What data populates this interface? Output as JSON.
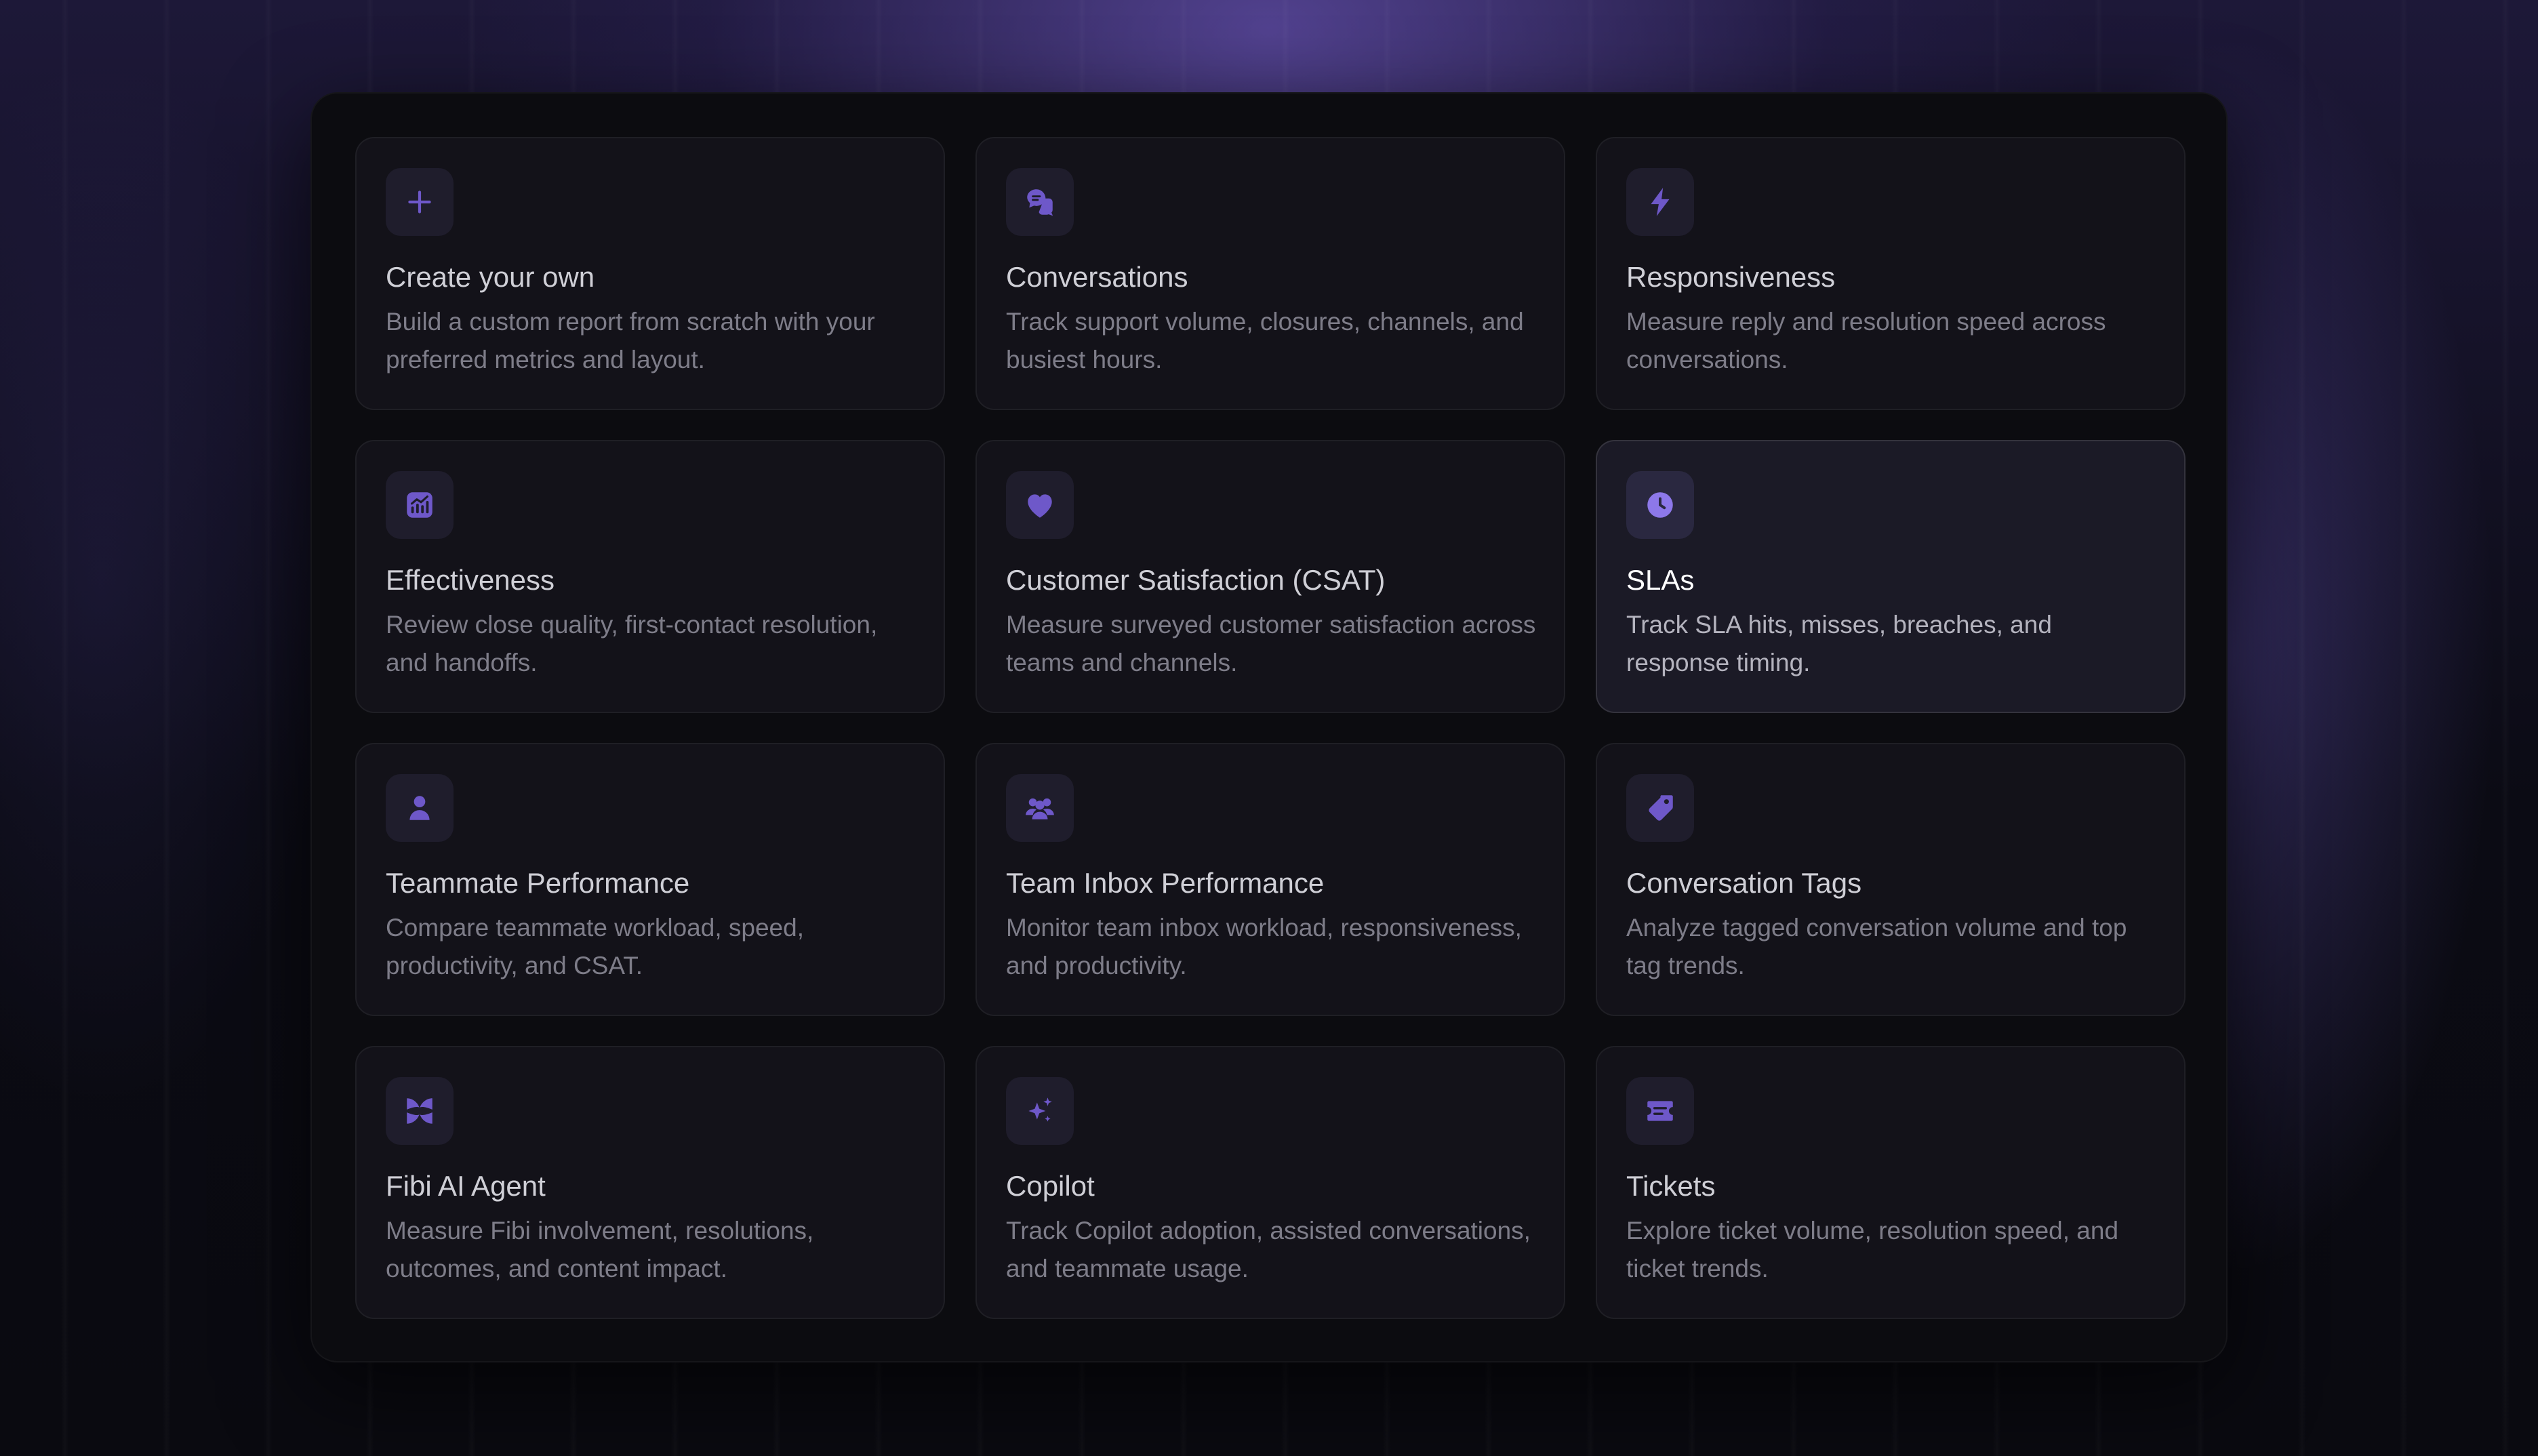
{
  "accent_color": "#6e58c9",
  "cards": [
    {
      "icon": "plus-icon",
      "title": "Create your own",
      "description": "Build a custom report from scratch with your preferred metrics and layout."
    },
    {
      "icon": "chat-bubbles-icon",
      "title": "Conversations",
      "description": "Track support volume, closures, channels, and busiest hours."
    },
    {
      "icon": "lightning-bolt-icon",
      "title": "Responsiveness",
      "description": "Measure reply and resolution speed across conversations."
    },
    {
      "icon": "chart-growth-icon",
      "title": "Effectiveness",
      "description": "Review close quality, first-contact resolution, and handoffs."
    },
    {
      "icon": "heart-icon",
      "title": "Customer Satisfaction (CSAT)",
      "description": "Measure surveyed customer satisfaction across teams and channels."
    },
    {
      "icon": "clock-icon",
      "title": "SLAs",
      "description": "Track SLA hits, misses, breaches, and response timing.",
      "selected": true
    },
    {
      "icon": "person-icon",
      "title": "Teammate Performance",
      "description": "Compare teammate workload, speed, productivity, and CSAT."
    },
    {
      "icon": "people-group-icon",
      "title": "Team Inbox Performance",
      "description": "Monitor team inbox workload, responsiveness, and productivity."
    },
    {
      "icon": "tag-icon",
      "title": "Conversation Tags",
      "description": "Analyze tagged conversation volume and top tag trends."
    },
    {
      "icon": "ai-agent-icon",
      "title": "Fibi AI Agent",
      "description": "Measure Fibi involvement, resolutions, outcomes, and content impact."
    },
    {
      "icon": "sparkles-icon",
      "title": "Copilot",
      "description": "Track Copilot adoption, assisted conversations, and teammate usage."
    },
    {
      "icon": "ticket-icon",
      "title": "Tickets",
      "description": "Explore ticket volume, resolution speed, and ticket trends."
    }
  ]
}
